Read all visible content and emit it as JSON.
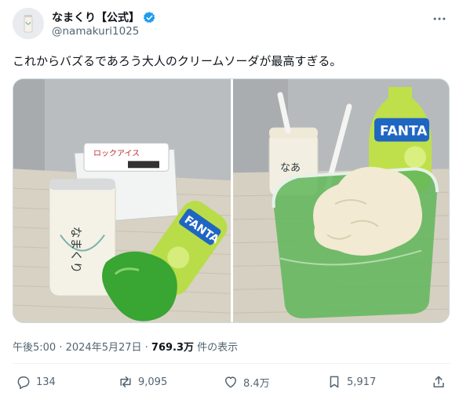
{
  "tweet": {
    "display_name": "なまくり【公式】",
    "handle": "@namakuri1025",
    "text": "これからバズるであろう大人のクリームソーダが最高すぎる。",
    "time": "午後5:00",
    "separator": " · ",
    "date": "2024年5月27日",
    "views_count": "769.3万",
    "views_suffix": " 件の表示"
  },
  "media": {
    "left_packs": {
      "ice_pack_label": "ロックアイス",
      "bottle_brand": "FANTA",
      "cup_brand": "なまくり"
    },
    "right_packs": {
      "cup_brand": "なあ",
      "bottle_brand": "FANTA"
    }
  },
  "actions": {
    "replies": "134",
    "retweets": "9,095",
    "likes": "8.4万",
    "bookmarks": "5,917"
  },
  "colors": {
    "verified": "#1d9bf0",
    "icon": "#536471",
    "text": "#0f1419"
  }
}
